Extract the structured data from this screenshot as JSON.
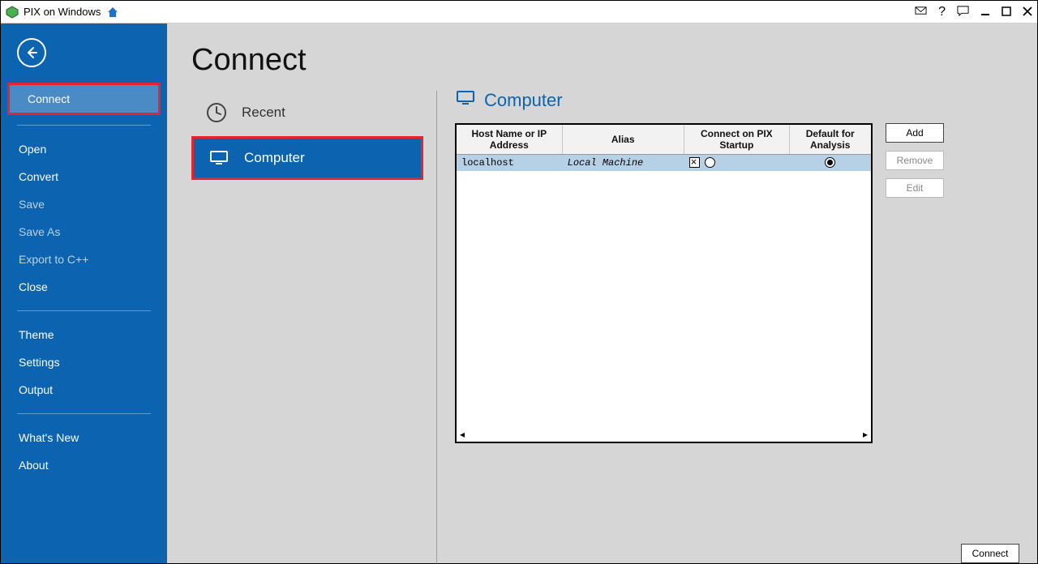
{
  "titlebar": {
    "title": "PIX on Windows"
  },
  "sidebar": {
    "items": {
      "connect": "Connect",
      "open": "Open",
      "convert": "Convert",
      "save": "Save",
      "saveas": "Save As",
      "export": "Export to C++",
      "close": "Close",
      "theme": "Theme",
      "settings": "Settings",
      "output": "Output",
      "whatsnew": "What's New",
      "about": "About"
    }
  },
  "main": {
    "title": "Connect",
    "categories": {
      "recent": "Recent",
      "computer": "Computer"
    },
    "section_title": "Computer",
    "buttons": {
      "add": "Add",
      "remove": "Remove",
      "edit": "Edit",
      "connect": "Connect"
    },
    "table": {
      "headers": {
        "host": "Host Name or IP Address",
        "alias": "Alias",
        "connect_on_startup": "Connect on PIX Startup",
        "default": "Default for Analysis"
      },
      "rows": [
        {
          "host": "localhost",
          "alias": "Local Machine",
          "connect_on_startup": true,
          "default": true
        }
      ]
    }
  }
}
